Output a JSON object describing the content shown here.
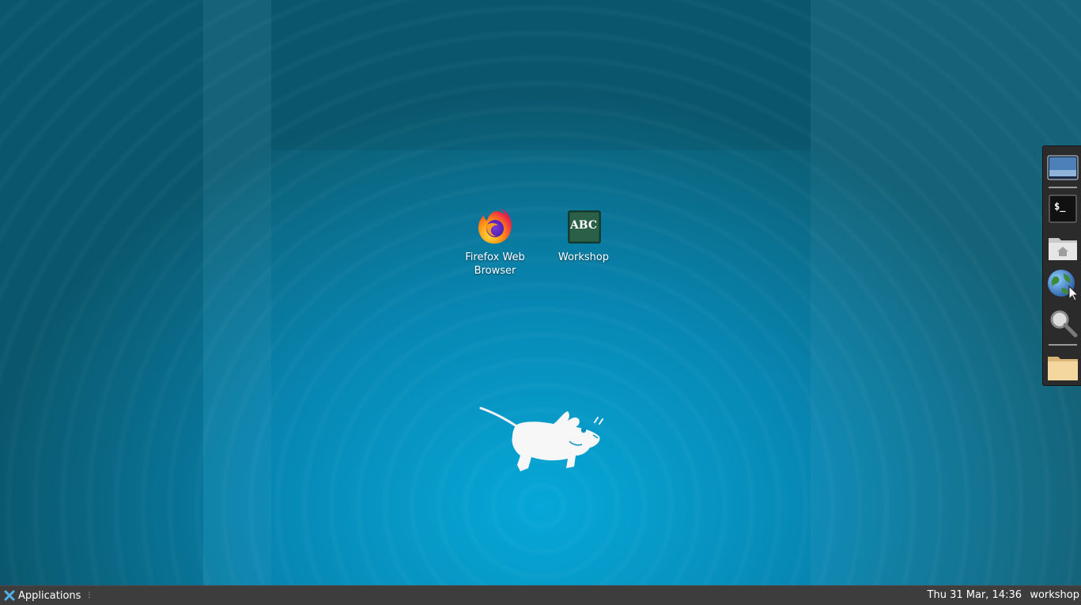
{
  "desktop": {
    "icons": [
      {
        "label": "Firefox Web Browser",
        "icon": "firefox-icon"
      },
      {
        "label": "Workshop",
        "icon": "chalkboard-icon",
        "badge_text": "ABC"
      }
    ],
    "wallpaper_logo": "xfce-mouse-logo"
  },
  "dock": {
    "items": [
      {
        "name": "show-desktop",
        "icon": "desktop-icon"
      },
      {
        "name": "terminal",
        "icon": "terminal-icon",
        "glyph": "$_"
      },
      {
        "name": "home-folder",
        "icon": "home-folder-icon"
      },
      {
        "name": "web-browser",
        "icon": "globe-cursor-icon"
      },
      {
        "name": "search",
        "icon": "magnifier-icon"
      },
      {
        "name": "file-manager",
        "icon": "folder-icon"
      }
    ]
  },
  "panel": {
    "apps_label": "Applications",
    "clock": "Thu 31 Mar, 14:36",
    "user": "workshop"
  },
  "colors": {
    "panel_bg": "#3d3d3d",
    "dock_bg": "#2b2b2b",
    "wallpaper_center": "#05a8d8",
    "wallpaper_edge": "#0b5d74"
  }
}
